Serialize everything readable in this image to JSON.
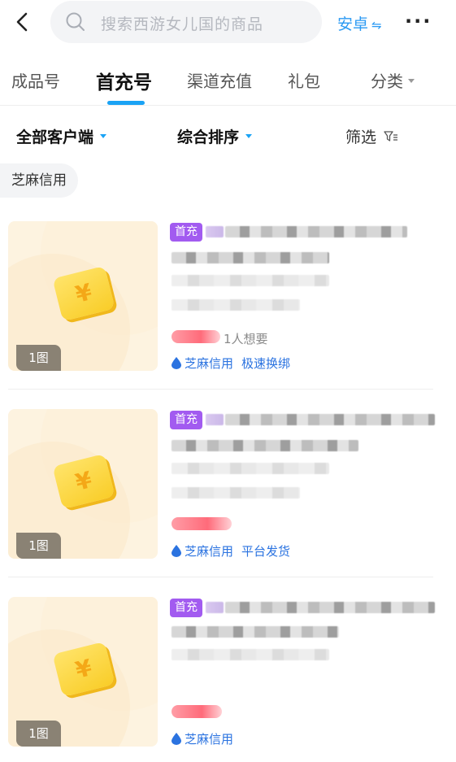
{
  "header": {
    "search_placeholder": "搜索西游女儿国的商品",
    "platform_label": "安卓",
    "platform_switch_icon": "⇋",
    "more_label": "···"
  },
  "tabs": [
    {
      "label": "成品号",
      "active": false
    },
    {
      "label": "首充号",
      "active": true
    },
    {
      "label": "渠道充值",
      "active": false
    },
    {
      "label": "礼包",
      "active": false
    },
    {
      "label": "分类",
      "active": false
    }
  ],
  "filters": {
    "client": "全部客户端",
    "sort": "综合排序",
    "filter": "筛选"
  },
  "chip": "芝麻信用",
  "listings": [
    {
      "badge": "首充",
      "image_count": "1图",
      "wants": "1人想要",
      "tags": [
        "芝麻信用",
        "极速换绑"
      ]
    },
    {
      "badge": "首充",
      "image_count": "1图",
      "wants": "",
      "tags": [
        "芝麻信用",
        "平台发货"
      ]
    },
    {
      "badge": "首充",
      "image_count": "1图",
      "wants": "",
      "tags": [
        "芝麻信用"
      ]
    }
  ],
  "colors": {
    "accent": "#1aa3f5",
    "link": "#2b9af3",
    "badge_bg": "#a25bf0",
    "tag_text": "#2b73e0"
  },
  "icons": {
    "back": "chevron-left-icon",
    "search": "search-icon",
    "filter": "funnel-icon",
    "credit": "water-drop-icon"
  }
}
